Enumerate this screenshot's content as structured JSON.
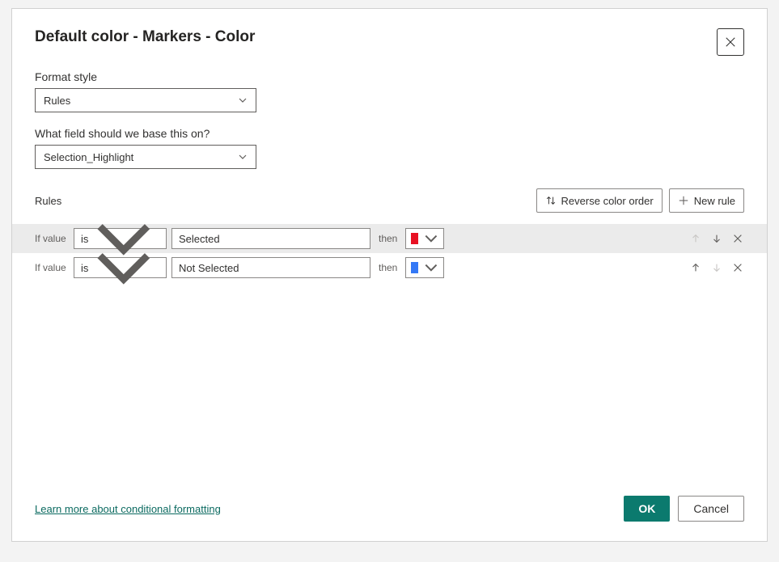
{
  "dialog": {
    "title": "Default color - Markers - Color"
  },
  "formatStyle": {
    "label": "Format style",
    "value": "Rules"
  },
  "fieldBase": {
    "label": "What field should we base this on?",
    "value": "Selection_Highlight"
  },
  "rulesSection": {
    "label": "Rules",
    "reverseOrderLabel": "Reverse color order",
    "newRuleLabel": "New rule"
  },
  "rules": [
    {
      "ifLabel": "If value",
      "operator": "is",
      "value": "Selected",
      "thenLabel": "then",
      "color": "#e81123",
      "highlighted": true
    },
    {
      "ifLabel": "If value",
      "operator": "is",
      "value": "Not Selected",
      "thenLabel": "then",
      "color": "#3478f6",
      "highlighted": false
    }
  ],
  "footer": {
    "learnMoreLabel": "Learn more about conditional formatting",
    "okLabel": "OK",
    "cancelLabel": "Cancel"
  }
}
